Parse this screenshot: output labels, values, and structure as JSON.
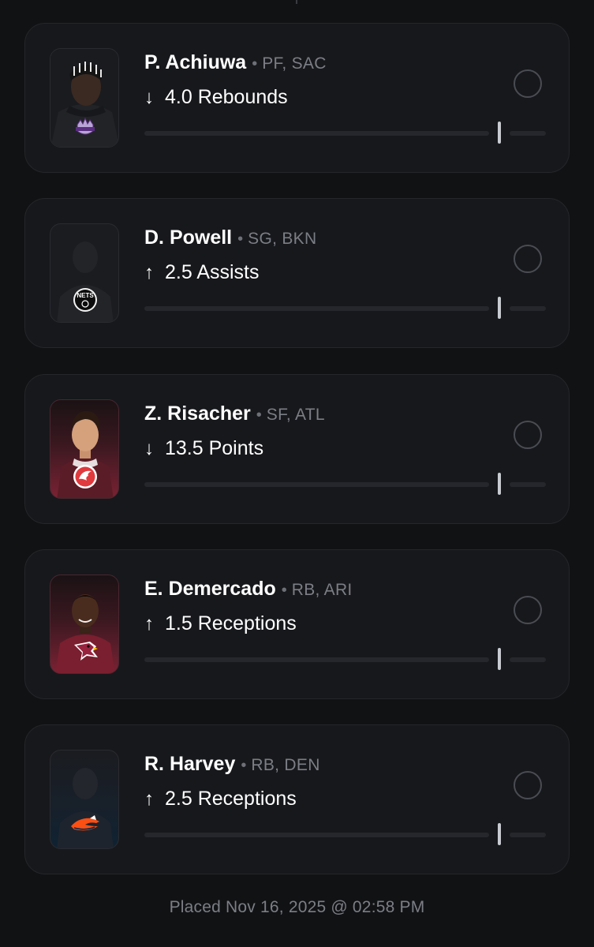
{
  "picks": [
    {
      "name": "P. Achiuwa",
      "position": "PF, SAC",
      "direction_arrow": "↓",
      "direction": "under",
      "line": "4.0 Rebounds",
      "team_logo_icon": "kings-logo-icon",
      "avatar_style": "photo-dark"
    },
    {
      "name": "D. Powell",
      "position": "SG, BKN",
      "direction_arrow": "↑",
      "direction": "over",
      "line": "2.5 Assists",
      "team_logo_icon": "nets-logo-icon",
      "team_logo_text": "NETS",
      "avatar_style": "silhouette"
    },
    {
      "name": "Z. Risacher",
      "position": "SF, ATL",
      "direction_arrow": "↓",
      "direction": "under",
      "line": "13.5 Points",
      "team_logo_icon": "hawks-logo-icon",
      "avatar_style": "photo-red"
    },
    {
      "name": "E. Demercado",
      "position": "RB, ARI",
      "direction_arrow": "↑",
      "direction": "over",
      "line": "1.5 Receptions",
      "team_logo_icon": "cardinals-logo-icon",
      "avatar_style": "photo-red"
    },
    {
      "name": "R. Harvey",
      "position": "RB, DEN",
      "direction_arrow": "↑",
      "direction": "over",
      "line": "2.5 Receptions",
      "team_logo_icon": "broncos-logo-icon",
      "avatar_style": "silhouette-blue"
    }
  ],
  "footer": {
    "placed_text": "Placed Nov 16, 2025 @ 02:58 PM"
  },
  "colors": {
    "background": "#111214",
    "card": "#17181b",
    "muted_text": "#7c7e86",
    "kings_purple": "#5a2d81",
    "hawks_red": "#e03a3e",
    "cardinals_red": "#97233f",
    "broncos_orange": "#fb4f14"
  }
}
